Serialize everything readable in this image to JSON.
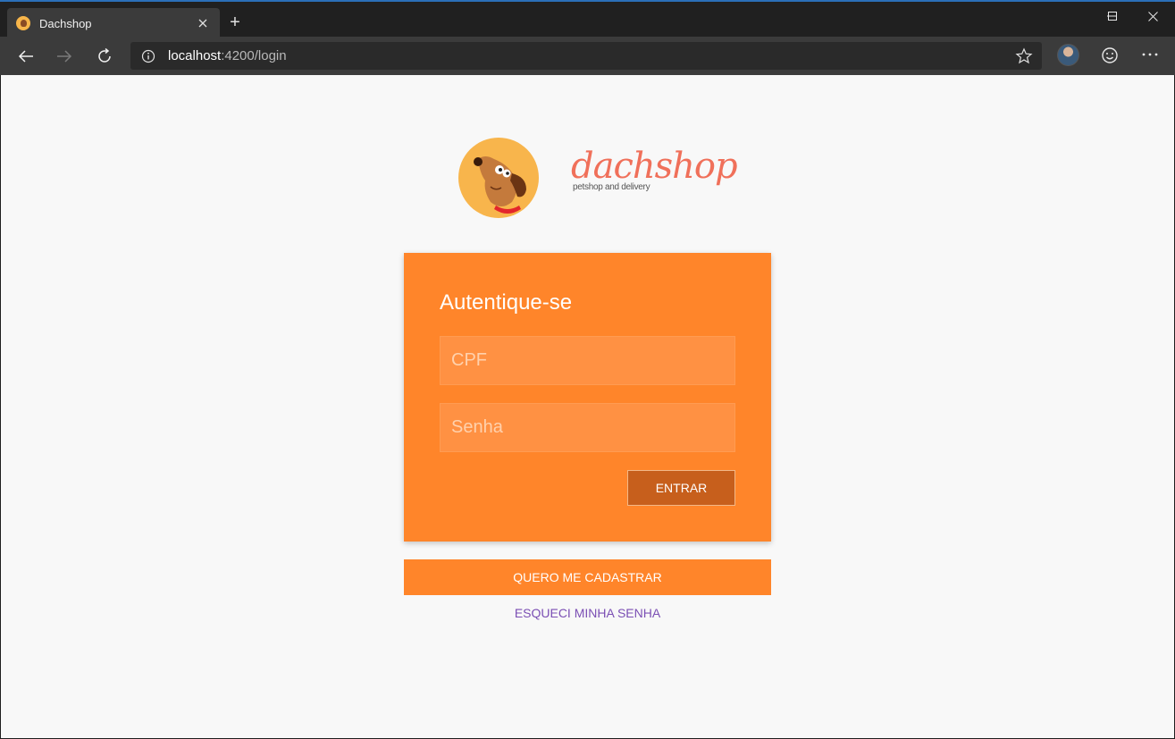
{
  "browser": {
    "tab_title": "Dachshop",
    "new_tab_symbol": "+",
    "url_host": "localhost",
    "url_path": ":4200/login"
  },
  "brand": {
    "name": "dachshop",
    "tagline": "petshop and delivery",
    "accent_color": "#f0705a"
  },
  "login_card": {
    "title": "Autentique-se",
    "cpf_placeholder": "CPF",
    "password_placeholder": "Senha",
    "submit_label": "ENTRAR",
    "card_color": "#ff852a"
  },
  "register_button_label": "QUERO ME CADASTRAR",
  "forgot_password_label": "ESQUECI MINHA SENHA",
  "icons": {
    "back": "back-arrow-icon",
    "forward": "forward-arrow-icon",
    "refresh": "refresh-icon",
    "info": "info-icon",
    "favorite": "star-icon",
    "feedback": "smiley-icon",
    "menu": "more-icon"
  }
}
